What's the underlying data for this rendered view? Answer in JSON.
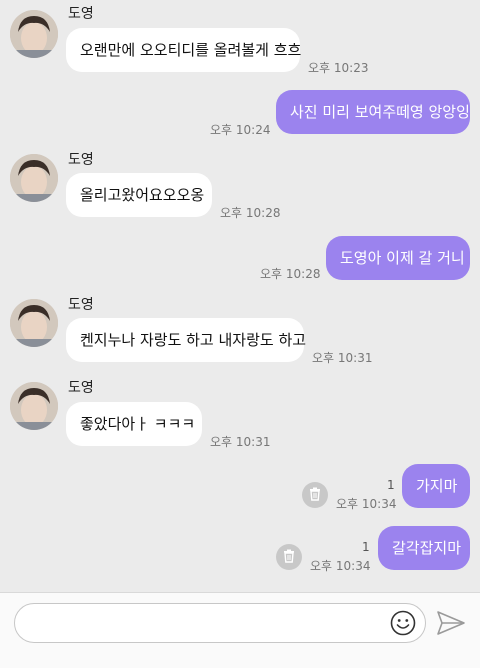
{
  "chat": {
    "incoming_1": {
      "sender": "도영",
      "text": "오랜만에 오오티디를 올려볼게 흐흐",
      "time": "오후 10:23"
    },
    "outgoing_1": {
      "text": "사진 미리 보여주떼영 앙앙잉",
      "time": "오후 10:24"
    },
    "incoming_2": {
      "sender": "도영",
      "text": "올리고왔어요오오옹",
      "time": "오후 10:28"
    },
    "outgoing_2": {
      "text": "도영아 이제 갈 거니",
      "time": "오후 10:28"
    },
    "incoming_3": {
      "sender": "도영",
      "text": "켄지누나 자랑도 하고 내자랑도 하고",
      "time": "오후 10:31"
    },
    "incoming_4": {
      "sender": "도영",
      "text": "좋았다아ㅏ ㅋㅋㅋ",
      "time": "오후 10:31"
    },
    "outgoing_3": {
      "text": "가지마",
      "time": "오후 10:34",
      "unread": "1"
    },
    "outgoing_4": {
      "text": "갈각잡지마",
      "time": "오후 10:34",
      "unread": "1"
    }
  },
  "input": {
    "placeholder": "",
    "emoji_icon": "smiley-icon",
    "send_icon": "send-icon"
  },
  "colors": {
    "background": "#ebebeb",
    "outgoing_bubble": "#9b83ee",
    "incoming_bubble": "#ffffff"
  }
}
